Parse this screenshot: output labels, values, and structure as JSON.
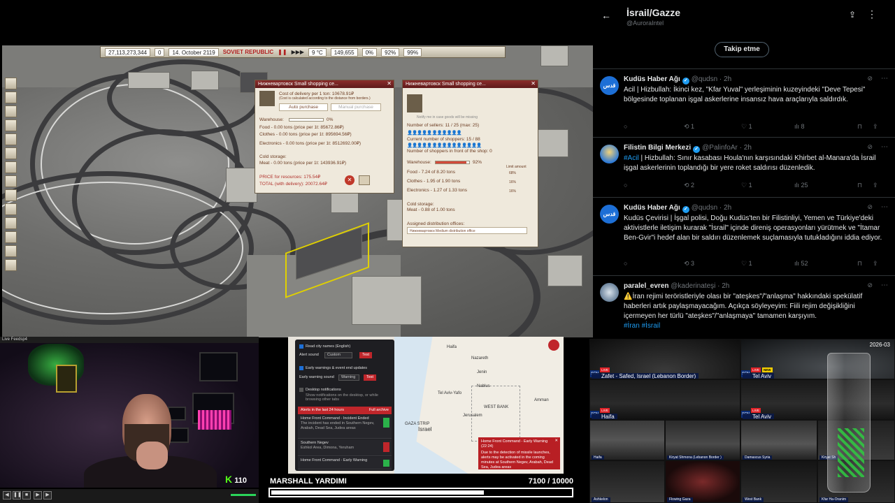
{
  "game": {
    "topbar": {
      "money": "27,113,273,344",
      "money2": "0",
      "date": "14. October 2119",
      "logo": "SOVIET REPUBLIC",
      "temp": "9 °C",
      "population": "149,655",
      "pct1": "0%",
      "pct2": "92%",
      "pct3": "99%"
    },
    "win1": {
      "title": "Нижневартовск Small shopping ce...",
      "cost": "Cost of delivery per 1 ton: 10678.91₽",
      "cost_note": "(Cost is calculated according to the distance from borders.)",
      "auto_btn": "Auto purchase",
      "manual_btn": "Manual purchase",
      "warehouse": "Warehouse:",
      "warehouse_pct": "0%",
      "food": "Food - 0.00 tons (price per 1t: 85672.86₽)",
      "clothes": "Clothes - 0.00 tons (price per 1t: 895694.56₽)",
      "electronics": "Electronics - 0.00 tons (price per 1t: 8512692.00₽)",
      "cold": "Cold storage:",
      "meat": "Meat - 0.00 tons (price per 1t: 143936.91₽)",
      "price_res": "PRICE for resources: 175.54₽",
      "total": "TOTAL (with delivery): 20072.64₽"
    },
    "win2": {
      "title": "Нижневартовск Small shopping ce...",
      "notify": "Notify me in case goods will be missing",
      "sellers": "Number of sellers: 11 / 25 (max: 25)",
      "shoppers": "Current number of shoppers: 15 / 88",
      "front": "Number of shoppers in front of the shop: 0",
      "warehouse": "Warehouse:",
      "warehouse_pct": "92%",
      "limit": "Limit amount",
      "food": "Food - 7.24 of 8.20 tons",
      "clothes": "Clothes - 1.95 of 1.90 tons",
      "electronics": "Electronics - 1.27 of 1.33 tons",
      "limit1": "68%",
      "limit2": "16%",
      "limit3": "16%",
      "cold": "Cold storage:",
      "meat": "Meat - 0.88 of 1.00 tons",
      "assigned": "Assigned distribution offices:",
      "office": "Нижневартовск Medium distribution office"
    }
  },
  "twitter": {
    "title": "İsrail/Gazze",
    "handle": "@AuroraIntel",
    "follow": "Takip etme",
    "tweets": [
      {
        "avatar": "قدس",
        "name": "Kudüs Haber Ağı",
        "handle": "@qudsn · 2h",
        "text": "Acil | Hizbullah: İkinci kez, \"Kfar Yuval\" yerleşiminin kuzeyindeki \"Deve Tepesi\" bölgesinde toplanan işgal askerlerine insansız hava araçlarıyla saldırdık.",
        "retweets": "1",
        "likes": "1",
        "views": "8"
      },
      {
        "avatar": "",
        "name": "Filistin Bilgi Merkezi",
        "handle": "@PalinfoAr · 2h",
        "hashtag": "#Acil",
        "text": " | Hizbullah: Sınır kasabası Houla'nın karşısındaki Khirbet al-Manara'da İsrail işgal askerlerinin toplandığı bir yere roket saldırısı düzenledik.",
        "retweets": "2",
        "likes": "1",
        "views": "25"
      },
      {
        "avatar": "قدس",
        "name": "Kudüs Haber Ağı",
        "handle": "@qudsn · 2h",
        "text": "Kudüs Çevirisi | İşgal polisi, Doğu Kudüs'ten bir Filistinliyi, Yemen ve Türkiye'deki aktivistlerle iletişim kurarak \"İsrail\" içinde direniş operasyonları yürütmek ve \"İtamar Ben-Gvir\"i hedef alan bir saldırı düzenlemek suçlamasıyla tutukladığını iddia ediyor.",
        "retweets": "3",
        "likes": "1",
        "views": "52"
      },
      {
        "avatar": "",
        "name": "paralel_evren",
        "handle": "@kaderinateşi · 2h",
        "text": "⚠️İran rejimi teröristleriyle olası bir \"ateşkes\"/\"anlaşma\" hakkındaki spekülatif haberleri artık paylaşmayacağım. Açıkça söyleyeyim: Fiili rejim değişikliğini içermeyen her türlü \"ateşkes\"/\"anlaşmaya\" tamamen karşıyım.",
        "hashtags": "#İran #İsrail"
      }
    ]
  },
  "webcam": {
    "label": "Live Feedsp4",
    "viewers": "110"
  },
  "alert_app": {
    "read_names": "Read city names (English)",
    "alert_sound": "Alert sound",
    "custom": "Custom",
    "test": "Test",
    "early": "Early warnings & event end updates",
    "early_sound": "Early warning sound",
    "warning": "Warning",
    "desktop": "Desktop notifications",
    "desktop_desc": "Show notifications on the desktop, or while browsing other tabs",
    "last24": "Alerts in the last 24 hours",
    "full": "Full archive",
    "items": [
      {
        "title": "Home Front Command - Incident Ended",
        "body": "The incident has ended in Southern Negev, Arabah, Dead Sea, Judea areas"
      },
      {
        "title": "Southern Negev",
        "body": "Eshkol Area, Dimona, Yeruham"
      },
      {
        "title": "Home Front Command - Early Warning",
        "body": ""
      }
    ],
    "map_labels": [
      "Haifa",
      "Nazareth",
      "Jenin",
      "Tel Aviv-Yafo",
      "Nablus",
      "WEST BANK",
      "Jerusalem",
      "Amman",
      "GAZA STRIP",
      "Israel"
    ],
    "popup_title": "Home Front Command - Early Warning (22:24)",
    "popup_body": "Due to the detection of missile launches, alerts may be activated in the coming minutes at Southern Negev, Arabah, Dead Sea, Judea areas"
  },
  "donation": {
    "title": "MARSHALL YARDIMI",
    "current": "7100",
    "goal": "/ 10000",
    "progress": 0.71
  },
  "cams": {
    "date": "2026-03",
    "cells": [
      {
        "caption": "Zafet - Safed, Israel (Lebanon Border)",
        "big": true
      },
      {
        "caption": "Tel Aviv",
        "big": true,
        "new": "NEW"
      },
      {
        "caption": "Haifa",
        "big": true
      },
      {
        "caption": "Tel Aviv",
        "big": true
      },
      {
        "caption": "Haifa",
        "big": false
      },
      {
        "caption": "Kiryat Shmona (Lebanon Border )",
        "big": false
      },
      {
        "caption": "Damascus Syria",
        "big": false
      },
      {
        "caption": "Kiryat Sh",
        "big": false
      },
      {
        "caption": "Ashkelon",
        "big": false
      },
      {
        "caption": "Flowing Gaza",
        "big": false
      },
      {
        "caption": "West Bank",
        "big": false
      },
      {
        "caption": "Kfar Ha-Oranim",
        "big": false
      }
    ]
  },
  "colors": {
    "twitter_bg": "#000000",
    "twitter_link": "#1d9bf0",
    "alert_red": "#c0262b",
    "kick_green": "#53fc18"
  }
}
